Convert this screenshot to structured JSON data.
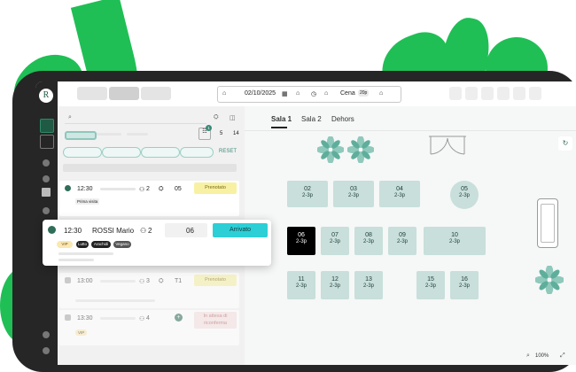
{
  "header": {
    "date": "02/10/2025",
    "service": "Cena",
    "service_badge": "20p"
  },
  "filters": {
    "count_a": "5",
    "count_b": "14",
    "notify_count": "1",
    "reset_label": "RESET"
  },
  "rooms": {
    "tabs": [
      {
        "label": "Sala 1",
        "active": true
      },
      {
        "label": "Sala 2",
        "active": false
      },
      {
        "label": "Dehors",
        "active": false
      }
    ]
  },
  "tables": [
    {
      "num": "02",
      "cap": "2-3p"
    },
    {
      "num": "03",
      "cap": "2-3p"
    },
    {
      "num": "04",
      "cap": "2-3p"
    },
    {
      "num": "05",
      "cap": "2-3p"
    },
    {
      "num": "06",
      "cap": "2-3p"
    },
    {
      "num": "07",
      "cap": "2-3p"
    },
    {
      "num": "08",
      "cap": "2-3p"
    },
    {
      "num": "09",
      "cap": "2-3p"
    },
    {
      "num": "10",
      "cap": "2-3p"
    },
    {
      "num": "11",
      "cap": "2-3p"
    },
    {
      "num": "12",
      "cap": "2-3p"
    },
    {
      "num": "13",
      "cap": "2-3p"
    },
    {
      "num": "15",
      "cap": "2-3p"
    },
    {
      "num": "16",
      "cap": "2-3p"
    }
  ],
  "reservations": [
    {
      "time": "12:30",
      "guests": "2",
      "table": "05",
      "status": "Prenotato",
      "note": "Prima visita"
    },
    {
      "time": "13:00",
      "guests": "3",
      "table": "T1",
      "status": "Prenotato"
    },
    {
      "time": "13:30",
      "guests": "4",
      "status": "In attesa di riconferma",
      "tag": "VIP"
    }
  ],
  "popup": {
    "time": "12:30",
    "name": "ROSSI Mario",
    "guests": "2",
    "table": "06",
    "action_label": "Arrivato",
    "tags": [
      "VIP",
      "Lutto",
      "Arachidi",
      "Vegano"
    ]
  },
  "map": {
    "zoom": "100%"
  },
  "colors": {
    "accent": "#2ccfd6",
    "table": "#c8dfdb",
    "brand": "#1fbf55",
    "status_booked": "#f8f1a4"
  }
}
